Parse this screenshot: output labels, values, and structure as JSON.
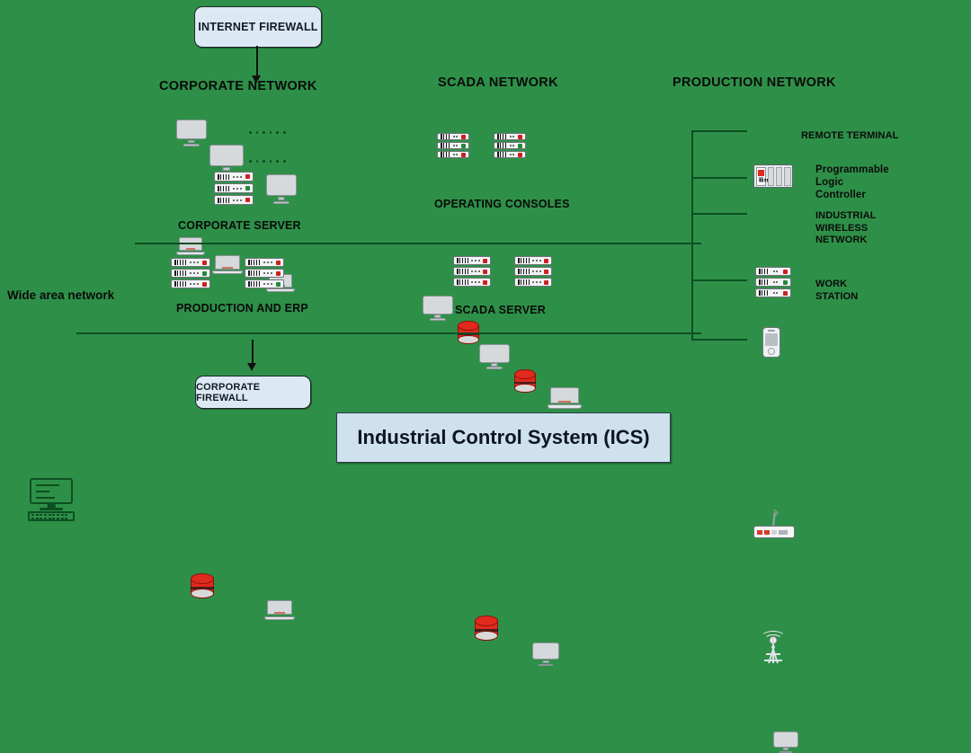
{
  "diagram": {
    "title": "Industrial Control System (ICS)",
    "background_color": "#2e9048",
    "line_color": "#0c4f22",
    "box_fill_color": "#dce9f5"
  },
  "boxes": {
    "internet_firewall": "INTERNET FIREWALL",
    "corporate_firewall": "CORPORATE FIREWALL"
  },
  "headings": {
    "corporate_network": "CORPORATE NETWORK",
    "scada_network": "SCADA NETWORK",
    "production_network": "PRODUCTION NETWORK"
  },
  "captions": {
    "corporate_server": "CORPORATE SERVER",
    "operating_consoles": "OPERATING CONSOLES",
    "production_and_erp": "PRODUCTION AND ERP",
    "scada_server": "SCADA SERVER",
    "wide_area_network": "Wide area network"
  },
  "production_nodes": [
    {
      "label": "REMOTE TERMINAL",
      "icon": "router-icon"
    },
    {
      "label": "Programmable\nLogic\nController",
      "icon": "plc-icon"
    },
    {
      "label": "INDUSTRIAL\nWIRELESS\nNETWORK",
      "icon": "wireless-tower-icon"
    },
    {
      "label": "WORK\nSTATION",
      "icon": "workstation-icon"
    },
    {
      "label": "",
      "icon": "mobile-phone-icon"
    }
  ]
}
